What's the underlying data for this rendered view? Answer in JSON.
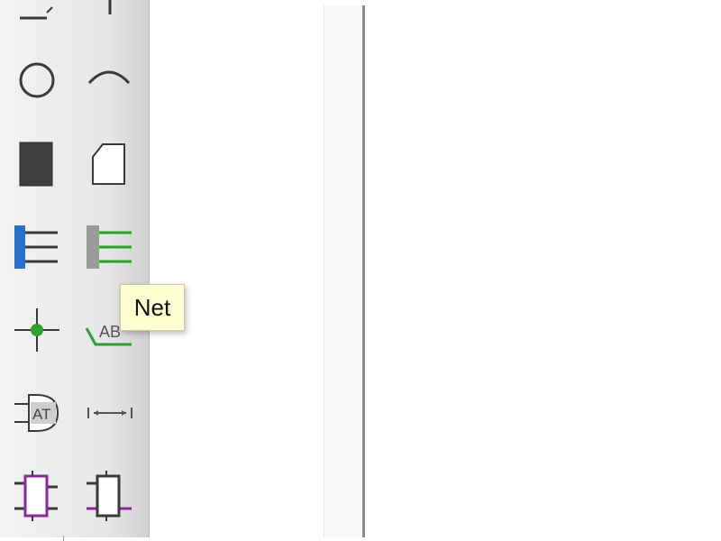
{
  "toolbar": {
    "tools": [
      {
        "id": "line",
        "icon": "line-icon"
      },
      {
        "id": "pin",
        "icon": "pin-icon"
      },
      {
        "id": "circle",
        "icon": "circle-icon"
      },
      {
        "id": "arc",
        "icon": "arc-icon"
      },
      {
        "id": "rectangle",
        "icon": "filled-rectangle-icon"
      },
      {
        "id": "polygon",
        "icon": "polygon-icon"
      },
      {
        "id": "bus",
        "icon": "bus-icon"
      },
      {
        "id": "bus-entry",
        "icon": "bus-entry-icon"
      },
      {
        "id": "junction",
        "icon": "junction-icon"
      },
      {
        "id": "net",
        "icon": "net-label-icon"
      },
      {
        "id": "attribute",
        "icon": "attribute-icon"
      },
      {
        "id": "dimension",
        "icon": "dimension-icon"
      },
      {
        "id": "frame",
        "icon": "frame-icon"
      },
      {
        "id": "part",
        "icon": "part-icon"
      }
    ]
  },
  "tooltip": {
    "text": "Net"
  },
  "colors": {
    "bus_blue": "#2a6fc9",
    "net_green": "#2ea02e",
    "frame_purple": "#8a2a9a",
    "icon_dark": "#3a3a3a"
  }
}
